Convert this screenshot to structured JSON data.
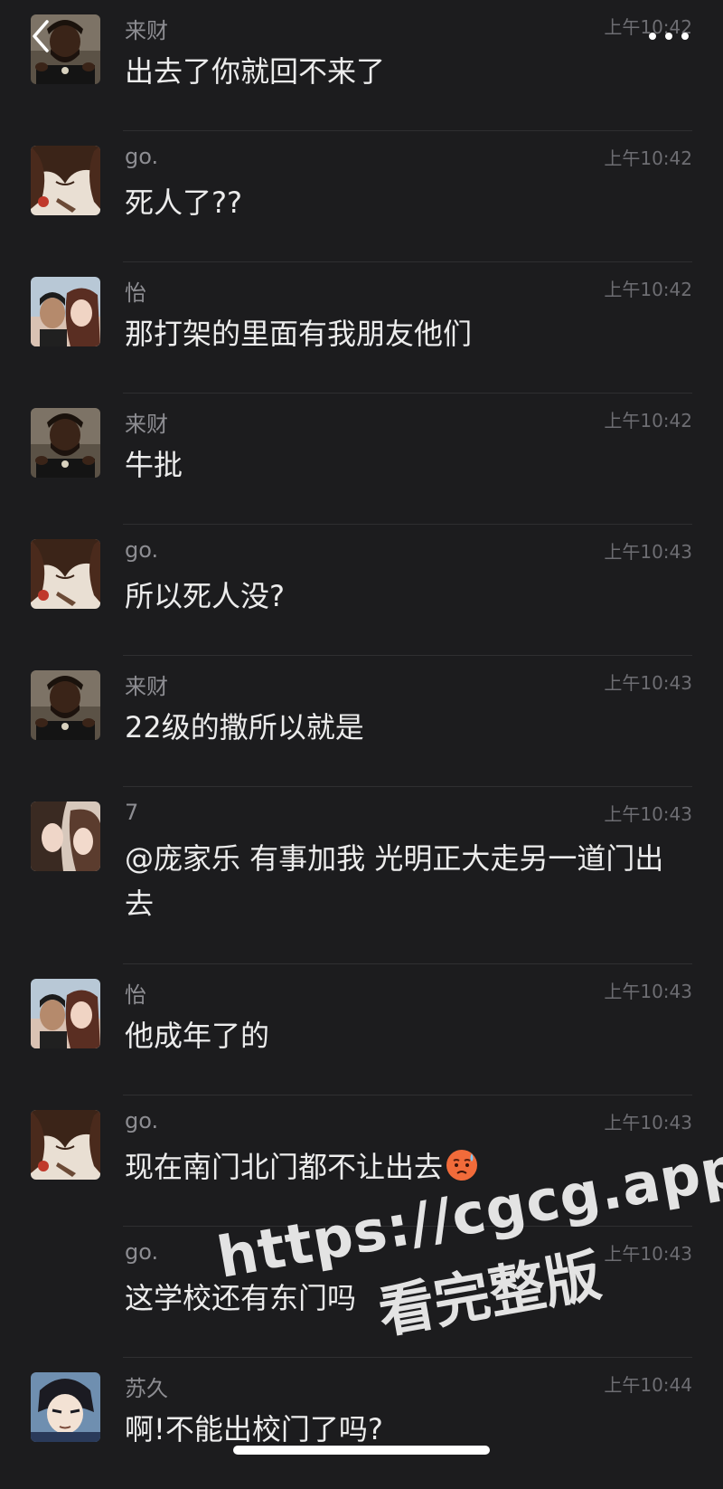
{
  "header": {
    "back_icon": "chevron-left-icon",
    "more_icon": "ellipsis-icon"
  },
  "messages": [
    {
      "sender": "来财",
      "time": "上午10:42",
      "text": "出去了你就回不来了",
      "avatar": "avatar-laicai"
    },
    {
      "sender": "go.",
      "time": "上午10:42",
      "text": "死人了??",
      "avatar": "avatar-go"
    },
    {
      "sender": "怡",
      "time": "上午10:42",
      "text": "那打架的里面有我朋友他们",
      "avatar": "avatar-yi"
    },
    {
      "sender": "来财",
      "time": "上午10:42",
      "text": "牛批",
      "avatar": "avatar-laicai"
    },
    {
      "sender": "go.",
      "time": "上午10:43",
      "text": "所以死人没?",
      "avatar": "avatar-go"
    },
    {
      "sender": "来财",
      "time": "上午10:43",
      "text": "22级的撒所以就是",
      "avatar": "avatar-laicai"
    },
    {
      "sender": "7",
      "time": "上午10:43",
      "text": "@庞家乐 有事加我 光明正大走另一道门出去",
      "avatar": "avatar-seven"
    },
    {
      "sender": "怡",
      "time": "上午10:43",
      "text": "他成年了的",
      "avatar": "avatar-yi"
    },
    {
      "sender": "go.",
      "time": "上午10:43",
      "text": "现在南门北门都不让出去",
      "avatar": "avatar-go",
      "emoji": "anxious-face-emoji"
    },
    {
      "sender": "go.",
      "time": "上午10:43",
      "text": "这学校还有东门吗",
      "avatar": ""
    },
    {
      "sender": "苏久",
      "time": "上午10:44",
      "text": "啊!不能出校门了吗?",
      "avatar": "avatar-sujiu"
    }
  ],
  "watermark": {
    "line1": "https://cgcg.app",
    "line2": "看完整版"
  },
  "colors": {
    "background": "#1c1c1e",
    "text": "#ececec",
    "sender": "#8d8d92",
    "time": "#6d6d72",
    "divider": "#2f2f31"
  }
}
